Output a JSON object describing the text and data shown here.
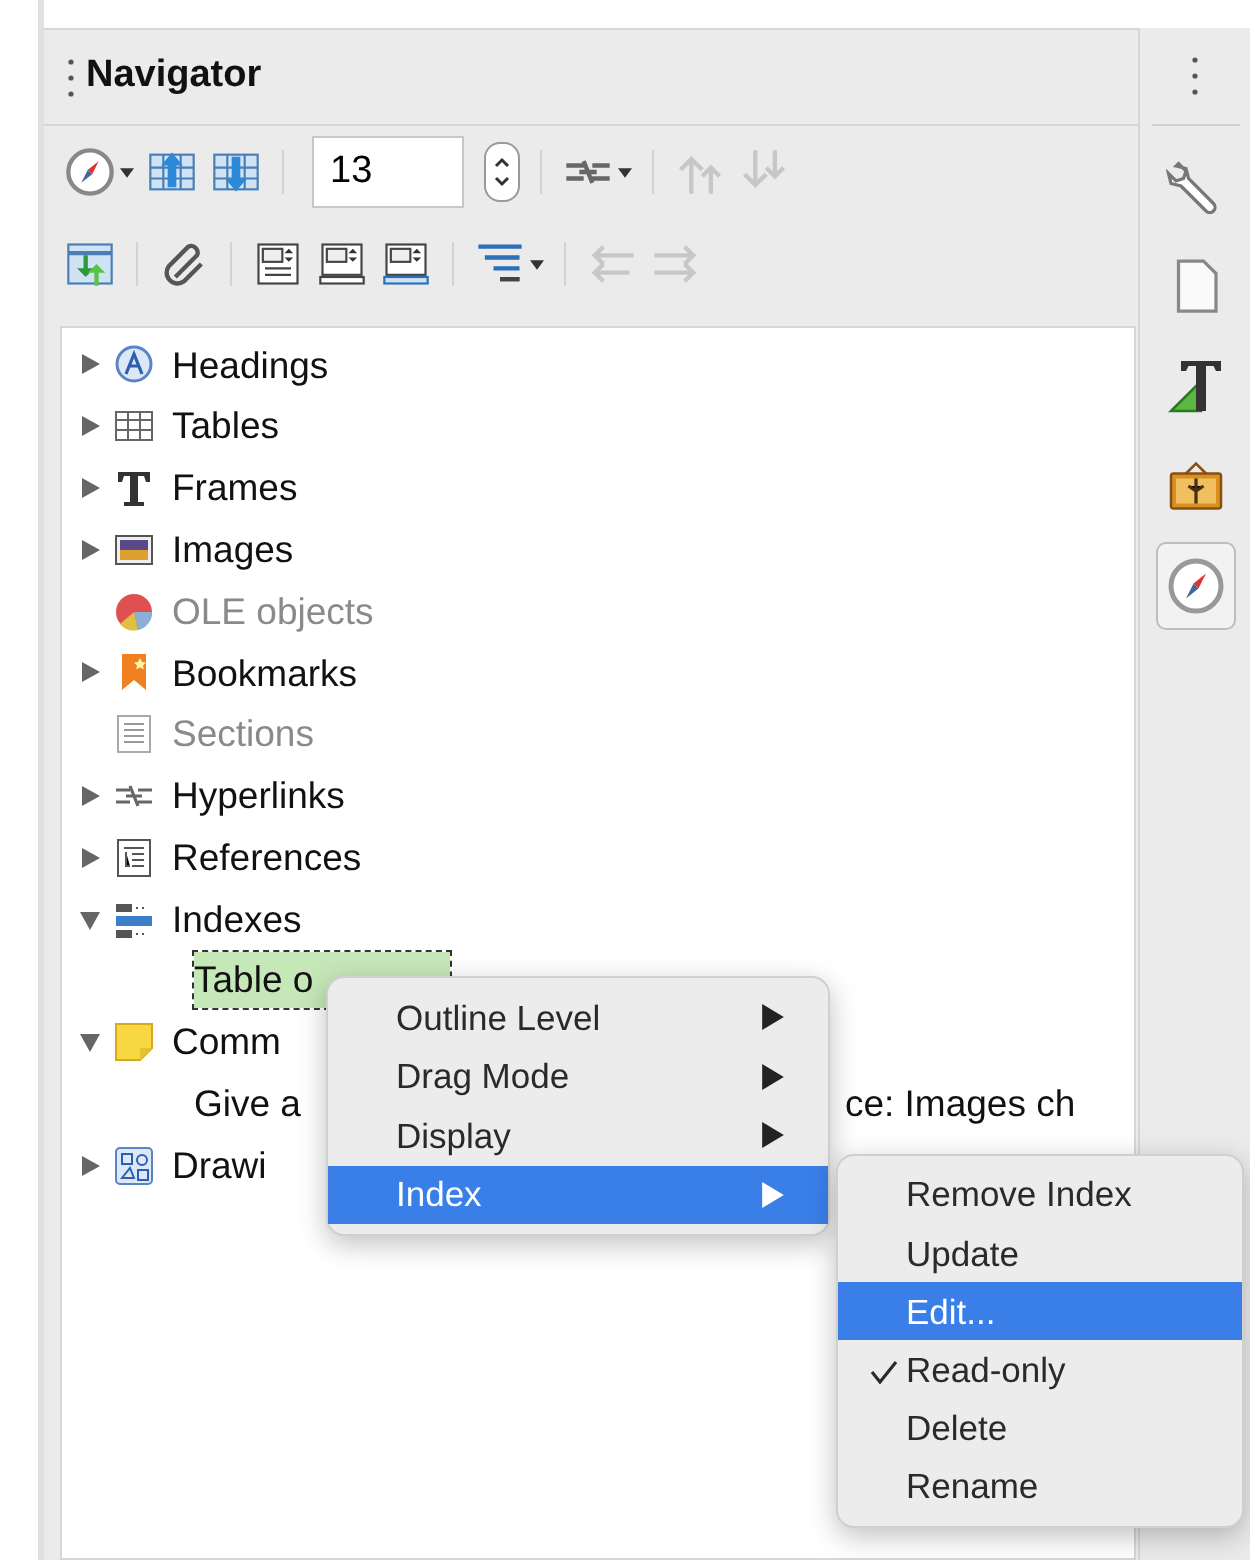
{
  "panel": {
    "title": "Navigator"
  },
  "toolbar_rows": [
    [
      {
        "kind": "button",
        "dropdown": true,
        "disabled": false
      },
      {
        "kind": "button",
        "dropdown": false,
        "disabled": false
      },
      {
        "kind": "button",
        "dropdown": false,
        "disabled": false
      },
      {
        "kind": "separator"
      },
      {
        "kind": "spin",
        "value": "13"
      },
      {
        "kind": "separator"
      },
      {
        "kind": "button",
        "dropdown": true,
        "disabled": false
      },
      {
        "kind": "separator"
      },
      {
        "kind": "button",
        "dropdown": false,
        "disabled": true
      },
      {
        "kind": "button",
        "dropdown": false,
        "disabled": true
      }
    ],
    [
      {
        "kind": "button",
        "dropdown": false,
        "disabled": false
      },
      {
        "kind": "separator"
      },
      {
        "kind": "button",
        "dropdown": false,
        "disabled": false
      },
      {
        "kind": "separator"
      },
      {
        "kind": "button",
        "dropdown": false,
        "disabled": false
      },
      {
        "kind": "button",
        "dropdown": false,
        "disabled": false
      },
      {
        "kind": "button",
        "dropdown": false,
        "disabled": false
      },
      {
        "kind": "separator"
      },
      {
        "kind": "button",
        "dropdown": true,
        "disabled": false
      },
      {
        "kind": "separator"
      },
      {
        "kind": "button",
        "dropdown": false,
        "disabled": true
      },
      {
        "kind": "button",
        "dropdown": false,
        "disabled": true
      }
    ]
  ],
  "tree": [
    {
      "label": "Headings",
      "expandable": true,
      "expanded": false,
      "disabled": false
    },
    {
      "label": "Tables",
      "expandable": true,
      "expanded": false,
      "disabled": false
    },
    {
      "label": "Frames",
      "expandable": true,
      "expanded": false,
      "disabled": false
    },
    {
      "label": "Images",
      "expandable": true,
      "expanded": false,
      "disabled": false
    },
    {
      "label": "OLE objects",
      "expandable": false,
      "disabled": true
    },
    {
      "label": "Bookmarks",
      "expandable": true,
      "expanded": false,
      "disabled": false
    },
    {
      "label": "Sections",
      "expandable": false,
      "disabled": true
    },
    {
      "label": "Hyperlinks",
      "expandable": true,
      "expanded": false,
      "disabled": false
    },
    {
      "label": "References",
      "expandable": true,
      "expanded": false,
      "disabled": false
    },
    {
      "label": "Indexes",
      "expandable": true,
      "expanded": true,
      "disabled": false,
      "children": [
        {
          "texts": [
            "Table o"
          ],
          "selected": true
        }
      ]
    },
    {
      "label": "Comm",
      "expandable": true,
      "expanded": true,
      "disabled": false,
      "children": [
        {
          "texts": [
            "Give a",
            "ce: Images ch"
          ],
          "selected": false
        }
      ]
    },
    {
      "label": "Drawi",
      "expandable": true,
      "expanded": false,
      "disabled": false
    }
  ],
  "context_menu": [
    {
      "label": "Outline Level",
      "submenu": true,
      "selected": false
    },
    {
      "label": "Drag Mode",
      "submenu": true,
      "selected": false
    },
    {
      "label": "Display",
      "submenu": true,
      "selected": false
    },
    {
      "label": "Index",
      "submenu": true,
      "selected": true
    }
  ],
  "submenu": [
    {
      "label": "Remove Index",
      "checked": false,
      "selected": false
    },
    {
      "label": "Update",
      "checked": false,
      "selected": false
    },
    {
      "label": "Edit...",
      "checked": false,
      "selected": true
    },
    {
      "label": "Read-only",
      "checked": true,
      "selected": false
    },
    {
      "label": "Delete",
      "checked": false,
      "selected": false
    },
    {
      "label": "Rename",
      "checked": false,
      "selected": false
    }
  ],
  "sidebar_tabs": [
    {
      "selected": false
    },
    {
      "selected": false
    },
    {
      "selected": false
    },
    {
      "selected": false
    },
    {
      "selected": true
    }
  ]
}
